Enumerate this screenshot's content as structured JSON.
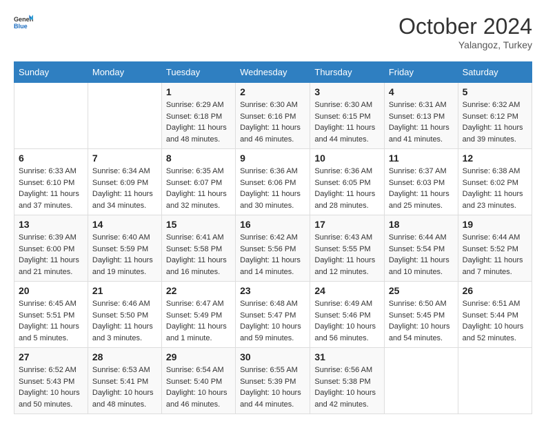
{
  "header": {
    "logo_general": "General",
    "logo_blue": "Blue",
    "month_title": "October 2024",
    "subtitle": "Yalangoz, Turkey"
  },
  "days_of_week": [
    "Sunday",
    "Monday",
    "Tuesday",
    "Wednesday",
    "Thursday",
    "Friday",
    "Saturday"
  ],
  "weeks": [
    [
      {
        "day": "",
        "info": ""
      },
      {
        "day": "",
        "info": ""
      },
      {
        "day": "1",
        "info": "Sunrise: 6:29 AM\nSunset: 6:18 PM\nDaylight: 11 hours and 48 minutes."
      },
      {
        "day": "2",
        "info": "Sunrise: 6:30 AM\nSunset: 6:16 PM\nDaylight: 11 hours and 46 minutes."
      },
      {
        "day": "3",
        "info": "Sunrise: 6:30 AM\nSunset: 6:15 PM\nDaylight: 11 hours and 44 minutes."
      },
      {
        "day": "4",
        "info": "Sunrise: 6:31 AM\nSunset: 6:13 PM\nDaylight: 11 hours and 41 minutes."
      },
      {
        "day": "5",
        "info": "Sunrise: 6:32 AM\nSunset: 6:12 PM\nDaylight: 11 hours and 39 minutes."
      }
    ],
    [
      {
        "day": "6",
        "info": "Sunrise: 6:33 AM\nSunset: 6:10 PM\nDaylight: 11 hours and 37 minutes."
      },
      {
        "day": "7",
        "info": "Sunrise: 6:34 AM\nSunset: 6:09 PM\nDaylight: 11 hours and 34 minutes."
      },
      {
        "day": "8",
        "info": "Sunrise: 6:35 AM\nSunset: 6:07 PM\nDaylight: 11 hours and 32 minutes."
      },
      {
        "day": "9",
        "info": "Sunrise: 6:36 AM\nSunset: 6:06 PM\nDaylight: 11 hours and 30 minutes."
      },
      {
        "day": "10",
        "info": "Sunrise: 6:36 AM\nSunset: 6:05 PM\nDaylight: 11 hours and 28 minutes."
      },
      {
        "day": "11",
        "info": "Sunrise: 6:37 AM\nSunset: 6:03 PM\nDaylight: 11 hours and 25 minutes."
      },
      {
        "day": "12",
        "info": "Sunrise: 6:38 AM\nSunset: 6:02 PM\nDaylight: 11 hours and 23 minutes."
      }
    ],
    [
      {
        "day": "13",
        "info": "Sunrise: 6:39 AM\nSunset: 6:00 PM\nDaylight: 11 hours and 21 minutes."
      },
      {
        "day": "14",
        "info": "Sunrise: 6:40 AM\nSunset: 5:59 PM\nDaylight: 11 hours and 19 minutes."
      },
      {
        "day": "15",
        "info": "Sunrise: 6:41 AM\nSunset: 5:58 PM\nDaylight: 11 hours and 16 minutes."
      },
      {
        "day": "16",
        "info": "Sunrise: 6:42 AM\nSunset: 5:56 PM\nDaylight: 11 hours and 14 minutes."
      },
      {
        "day": "17",
        "info": "Sunrise: 6:43 AM\nSunset: 5:55 PM\nDaylight: 11 hours and 12 minutes."
      },
      {
        "day": "18",
        "info": "Sunrise: 6:44 AM\nSunset: 5:54 PM\nDaylight: 11 hours and 10 minutes."
      },
      {
        "day": "19",
        "info": "Sunrise: 6:44 AM\nSunset: 5:52 PM\nDaylight: 11 hours and 7 minutes."
      }
    ],
    [
      {
        "day": "20",
        "info": "Sunrise: 6:45 AM\nSunset: 5:51 PM\nDaylight: 11 hours and 5 minutes."
      },
      {
        "day": "21",
        "info": "Sunrise: 6:46 AM\nSunset: 5:50 PM\nDaylight: 11 hours and 3 minutes."
      },
      {
        "day": "22",
        "info": "Sunrise: 6:47 AM\nSunset: 5:49 PM\nDaylight: 11 hours and 1 minute."
      },
      {
        "day": "23",
        "info": "Sunrise: 6:48 AM\nSunset: 5:47 PM\nDaylight: 10 hours and 59 minutes."
      },
      {
        "day": "24",
        "info": "Sunrise: 6:49 AM\nSunset: 5:46 PM\nDaylight: 10 hours and 56 minutes."
      },
      {
        "day": "25",
        "info": "Sunrise: 6:50 AM\nSunset: 5:45 PM\nDaylight: 10 hours and 54 minutes."
      },
      {
        "day": "26",
        "info": "Sunrise: 6:51 AM\nSunset: 5:44 PM\nDaylight: 10 hours and 52 minutes."
      }
    ],
    [
      {
        "day": "27",
        "info": "Sunrise: 6:52 AM\nSunset: 5:43 PM\nDaylight: 10 hours and 50 minutes."
      },
      {
        "day": "28",
        "info": "Sunrise: 6:53 AM\nSunset: 5:41 PM\nDaylight: 10 hours and 48 minutes."
      },
      {
        "day": "29",
        "info": "Sunrise: 6:54 AM\nSunset: 5:40 PM\nDaylight: 10 hours and 46 minutes."
      },
      {
        "day": "30",
        "info": "Sunrise: 6:55 AM\nSunset: 5:39 PM\nDaylight: 10 hours and 44 minutes."
      },
      {
        "day": "31",
        "info": "Sunrise: 6:56 AM\nSunset: 5:38 PM\nDaylight: 10 hours and 42 minutes."
      },
      {
        "day": "",
        "info": ""
      },
      {
        "day": "",
        "info": ""
      }
    ]
  ]
}
